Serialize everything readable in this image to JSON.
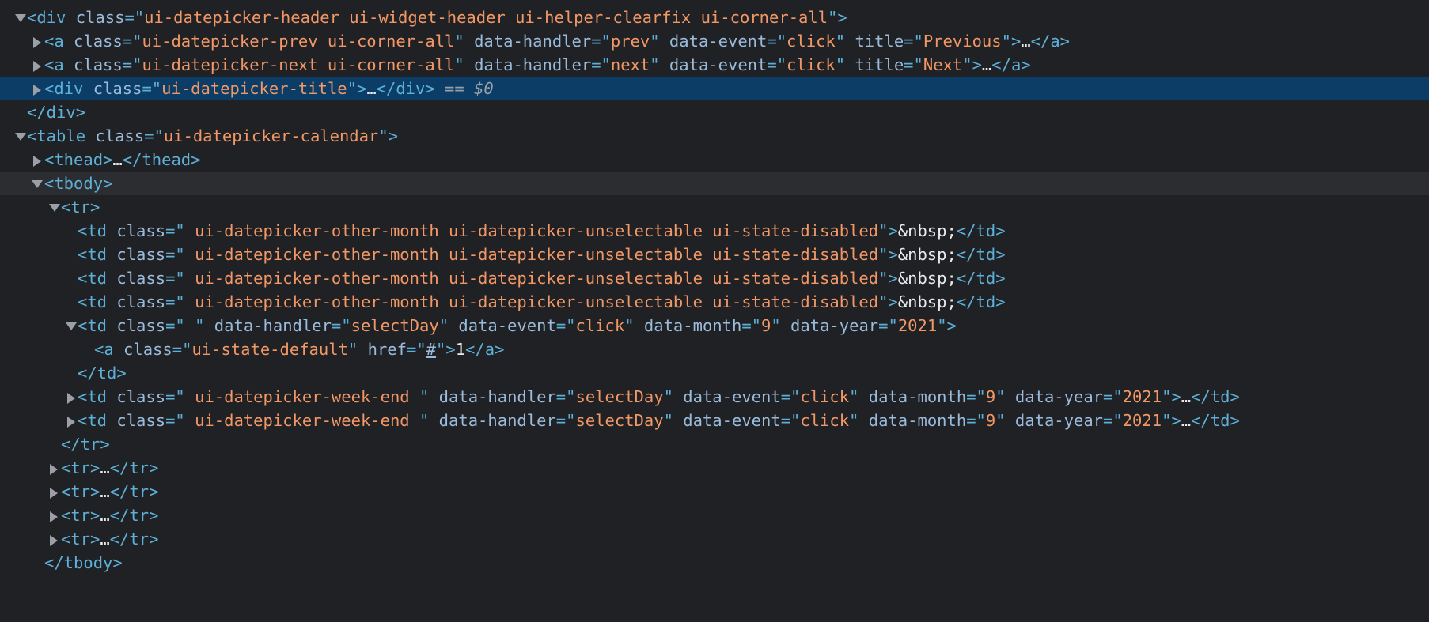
{
  "elements_tree": {
    "lines": [
      {
        "text_parts": [
          "<div",
          " class",
          "=\"",
          "ui-datepicker-header ui-widget-header ui-helper-clearfix ui-corner-all",
          "\">"
        ]
      },
      {
        "text_parts": [
          "<a",
          " class",
          "=\"",
          "ui-datepicker-prev ui-corner-all",
          "\"",
          " data-handler",
          "=\"",
          "prev",
          "\"",
          " data-event",
          "=\"",
          "click",
          "\"",
          " title",
          "=\"",
          "Previous",
          "\">",
          "…",
          "</a>"
        ]
      },
      {
        "text_parts": [
          "<a",
          " class",
          "=\"",
          "ui-datepicker-next ui-corner-all",
          "\"",
          " data-handler",
          "=\"",
          "next",
          "\"",
          " data-event",
          "=\"",
          "click",
          "\"",
          " title",
          "=\"",
          "Next",
          "\">",
          "…",
          "</a>"
        ]
      },
      {
        "text_parts": [
          "<div",
          " class",
          "=\"",
          "ui-datepicker-title",
          "\">",
          "…",
          "</div>",
          " == $0"
        ]
      },
      {
        "text_parts": [
          "</div>"
        ]
      },
      {
        "text_parts": [
          "<table",
          " class",
          "=\"",
          "ui-datepicker-calendar",
          "\">"
        ]
      },
      {
        "text_parts": [
          "<thead>",
          "…",
          "</thead>"
        ]
      },
      {
        "text_parts": [
          "<tbody>"
        ]
      },
      {
        "text_parts": [
          "<tr>"
        ]
      },
      {
        "text_parts": [
          "<td",
          " class",
          "=\"",
          " ui-datepicker-other-month ui-datepicker-unselectable ui-state-disabled",
          "\">",
          "&nbsp;",
          "</td>"
        ]
      },
      {
        "text_parts": [
          "<td",
          " class",
          "=\"",
          " ui-datepicker-other-month ui-datepicker-unselectable ui-state-disabled",
          "\">",
          "&nbsp;",
          "</td>"
        ]
      },
      {
        "text_parts": [
          "<td",
          " class",
          "=\"",
          " ui-datepicker-other-month ui-datepicker-unselectable ui-state-disabled",
          "\">",
          "&nbsp;",
          "</td>"
        ]
      },
      {
        "text_parts": [
          "<td",
          " class",
          "=\"",
          " ui-datepicker-other-month ui-datepicker-unselectable ui-state-disabled",
          "\">",
          "&nbsp;",
          "</td>"
        ]
      },
      {
        "text_parts": [
          "<td",
          " class",
          "=\"",
          " ",
          "\"",
          " data-handler",
          "=\"",
          "selectDay",
          "\"",
          " data-event",
          "=\"",
          "click",
          "\"",
          " data-month",
          "=\"",
          "9",
          "\"",
          " data-year",
          "=\"",
          "2021",
          "\">"
        ]
      },
      {
        "text_parts": [
          "<a",
          " class",
          "=\"",
          "ui-state-default",
          "\"",
          " href",
          "=\"",
          "#",
          "\">",
          "1",
          "</a>"
        ]
      },
      {
        "text_parts": [
          "</td>"
        ]
      },
      {
        "text_parts": [
          "<td",
          " class",
          "=\"",
          " ui-datepicker-week-end ",
          "\"",
          " data-handler",
          "=\"",
          "selectDay",
          "\"",
          " data-event",
          "=\"",
          "click",
          "\"",
          " data-month",
          "=\"",
          "9",
          "\"",
          " data-year",
          "=\"",
          "2021",
          "\">",
          "…",
          "</td>"
        ]
      },
      {
        "text_parts": [
          "<td",
          " class",
          "=\"",
          " ui-datepicker-week-end ",
          "\"",
          " data-handler",
          "=\"",
          "selectDay",
          "\"",
          " data-event",
          "=\"",
          "click",
          "\"",
          " data-month",
          "=\"",
          "9",
          "\"",
          " data-year",
          "=\"",
          "2021",
          "\">",
          "…",
          "</td>"
        ]
      },
      {
        "text_parts": [
          "</tr>"
        ]
      },
      {
        "text_parts": [
          "<tr>",
          "…",
          "</tr>"
        ]
      },
      {
        "text_parts": [
          "<tr>",
          "…",
          "</tr>"
        ]
      },
      {
        "text_parts": [
          "<tr>",
          "…",
          "</tr>"
        ]
      },
      {
        "text_parts": [
          "<tr>",
          "…",
          "</tr>"
        ]
      },
      {
        "text_parts": [
          "</tbody>"
        ]
      }
    ]
  },
  "colors": {
    "background": "#202124",
    "selected_row": "#0b3d66",
    "hover_row": "#2b2d31",
    "tag": "#5db0d7",
    "attribute_name": "#9bbbdc",
    "attribute_value": "#f29766",
    "text": "#e8eaed",
    "console_ref": "#9aa0a6"
  }
}
